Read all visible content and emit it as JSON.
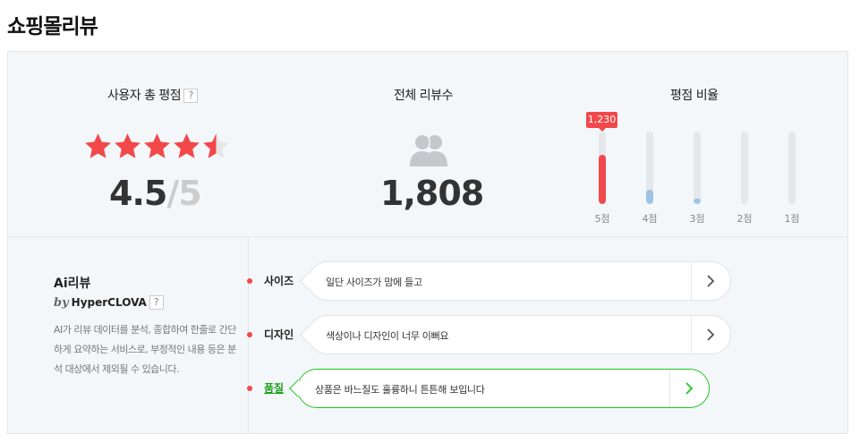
{
  "page": {
    "title": "쇼핑몰리뷰"
  },
  "summary": {
    "score_title": "사용자 총 평점",
    "help": "?",
    "rating": 4.5,
    "score": "4.5",
    "slash": "/",
    "max": "5",
    "count_title": "전체 리뷰수",
    "total_reviews": "1,808",
    "distribution_title": "평점 비율"
  },
  "distribution": [
    {
      "label": "5점",
      "level": 0.68,
      "color": "#f2484a",
      "count": "1,230"
    },
    {
      "label": "4점",
      "level": 0.2,
      "color": "#9dc3e4"
    },
    {
      "label": "3점",
      "level": 0.07,
      "color": "#9dc3e4"
    },
    {
      "label": "2점",
      "level": 0.0,
      "color": "#9dc3e4"
    },
    {
      "label": "1점",
      "level": 0.0,
      "color": "#9dc3e4"
    }
  ],
  "ai_review": {
    "title": "Ai리뷰",
    "by": "by",
    "brand": "HyperCLOVA",
    "help": "?",
    "description": "AI가 리뷰 데이터를 분석, 종합하여 한줄로 간단하게 요약하는 서비스로, 부정적인 내용 등은 분석 대상에서 제외될 수 있습니다.",
    "topics": [
      {
        "label": "사이즈",
        "summary": "일단 사이즈가 맘에 들고",
        "active": false
      },
      {
        "label": "디자인",
        "summary": "색상이나 디자인이 너무 이뻐요",
        "active": false
      },
      {
        "label": "품질",
        "summary": "상품은 바느질도 훌륭하니 튼튼해 보입니다",
        "active": true
      }
    ]
  },
  "colors": {
    "accent_red": "#f2484a",
    "accent_green": "#1ec51e",
    "star_empty": "#e6e6e6"
  }
}
